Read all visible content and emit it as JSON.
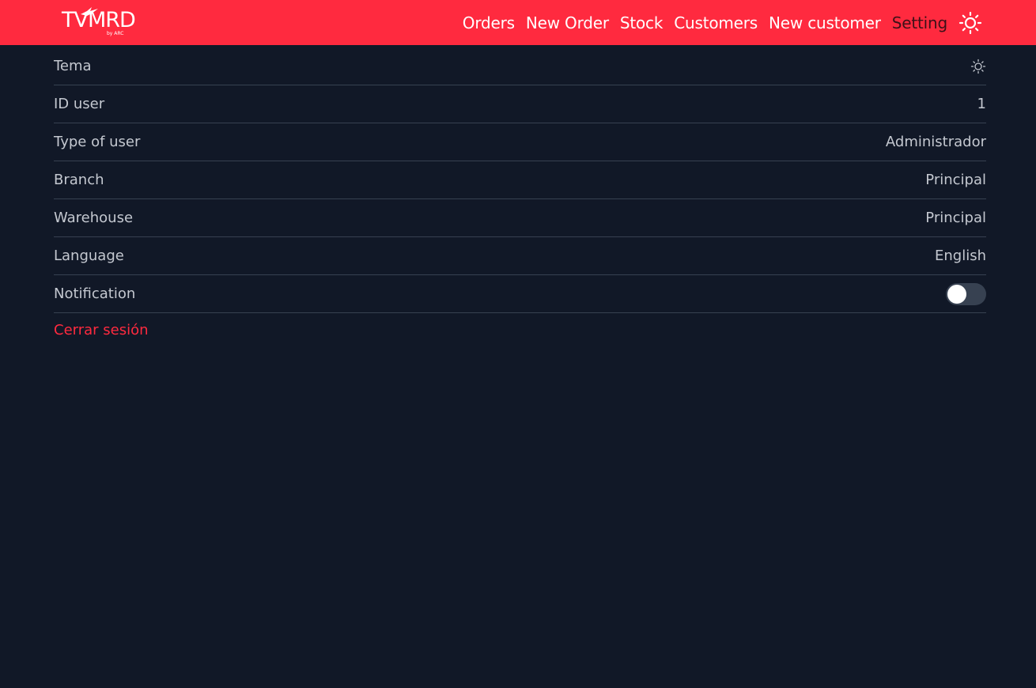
{
  "header": {
    "logo_text": "TVMRD",
    "logo_sub": "by ARC",
    "nav": [
      {
        "label": "Orders"
      },
      {
        "label": "New Order"
      },
      {
        "label": "Stock"
      },
      {
        "label": "Customers"
      },
      {
        "label": "New customer"
      },
      {
        "label": "Setting"
      }
    ],
    "theme_icon": "sun-icon"
  },
  "settings": {
    "rows": [
      {
        "label": "Tema",
        "value_icon": "sun-icon"
      },
      {
        "label": "ID user",
        "value": "1"
      },
      {
        "label": "Type of user",
        "value": "Administrador"
      },
      {
        "label": "Branch",
        "value": "Principal"
      },
      {
        "label": "Warehouse",
        "value": "Principal"
      },
      {
        "label": "Language",
        "value": "English"
      },
      {
        "label": "Notification",
        "toggle": false
      }
    ],
    "logout_label": "Cerrar sesión"
  },
  "colors": {
    "accent": "#ff2a3f",
    "background": "#111827",
    "divider": "#374151",
    "text": "#c4c8d0"
  }
}
